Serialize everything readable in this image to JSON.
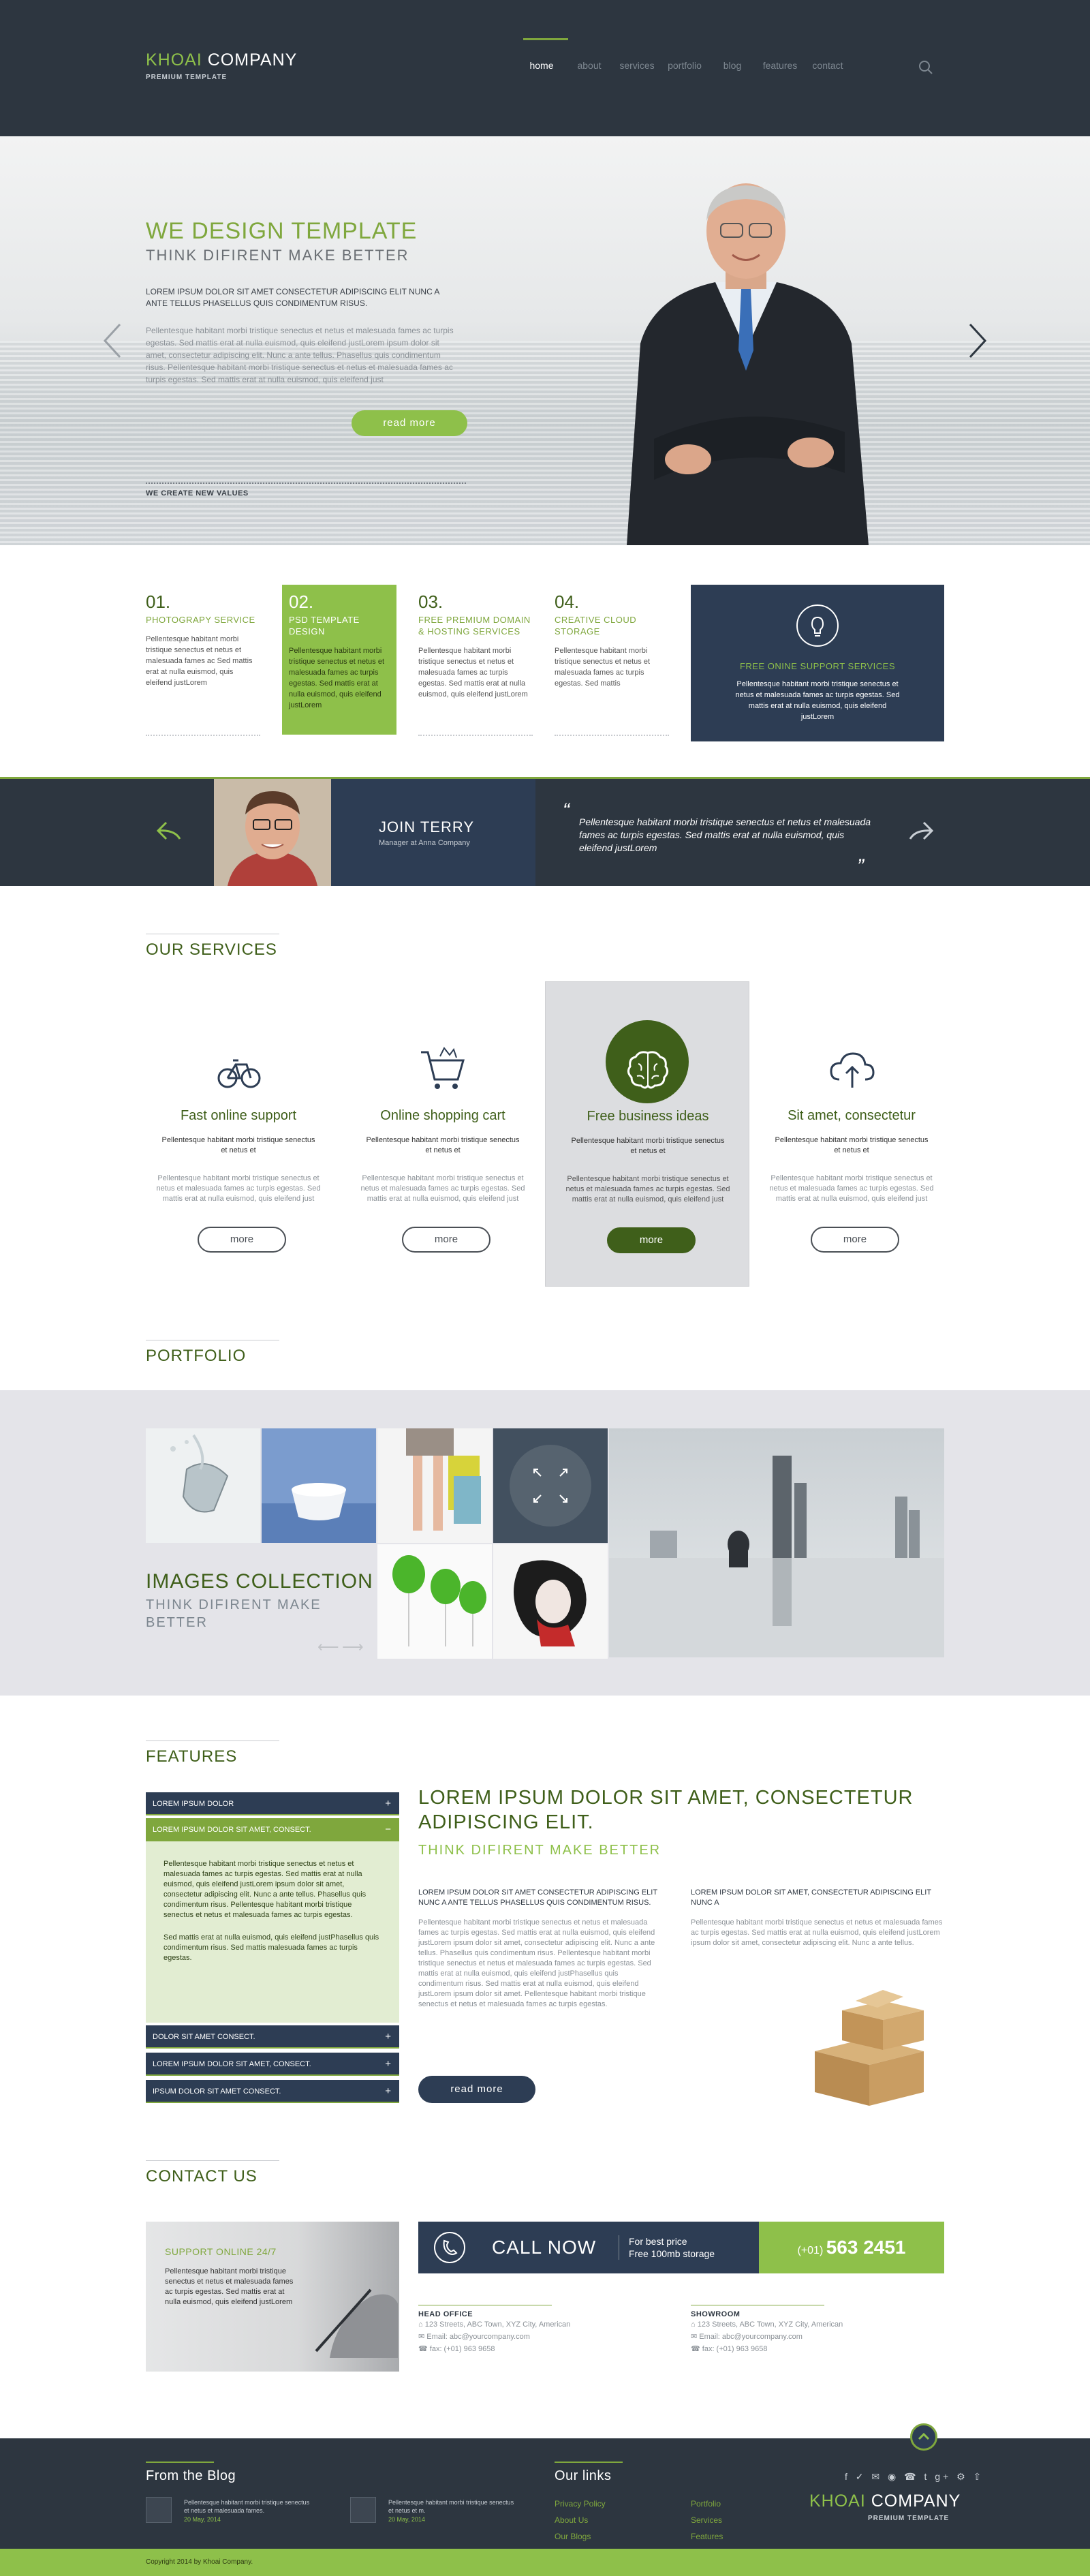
{
  "header": {
    "logo_part1": "KHOAI",
    "logo_part2": "COMPANY",
    "logo_sub": "PREMIUM TEMPLATE",
    "nav": [
      "home",
      "about",
      "services",
      "portfolio",
      "blog",
      "features",
      "contact"
    ]
  },
  "hero": {
    "title": "WE DESIGN TEMPLATE",
    "subtitle": "THINK DIFIRENT MAKE BETTER",
    "lead": "LOREM IPSUM DOLOR SIT AMET CONSECTETUR ADIPISCING ELIT NUNC A ANTE TELLUS PHASELLUS QUIS CONDIMENTUM RISUS.",
    "body": "Pellentesque habitant morbi tristique senectus et netus et malesuada fames ac turpis egestas. Sed mattis erat at nulla euismod, quis eleifend justLorem ipsum dolor sit amet, consectetur adipiscing elit. Nunc a ante tellus. Phasellus quis condimentum risus. Pellentesque habitant morbi tristique senectus et netus et malesuada fames ac turpis egestas. Sed mattis erat at nulla euismod, quis eleifend just",
    "button": "read more",
    "note": "WE CREATE NEW VALUES"
  },
  "services_row": [
    {
      "num": "01.",
      "title": "PHOTOGRAPY SERVICE",
      "text": "Pellentesque habitant morbi tristique senectus et netus et malesuada fames ac Sed mattis erat at nulla euismod, quis eleifend justLorem"
    },
    {
      "num": "02.",
      "title": "PSD TEMPLATE DESIGN",
      "text": "Pellentesque habitant morbi tristique senectus et netus et malesuada fames ac turpis egestas. Sed mattis erat at nulla euismod, quis eleifend justLorem"
    },
    {
      "num": "03.",
      "title": "FREE PREMIUM DOMAIN & HOSTING SERVICES",
      "text": "Pellentesque habitant morbi tristique senectus et netus et malesuada fames ac turpis egestas. Sed mattis erat at nulla euismod, quis eleifend justLorem"
    },
    {
      "num": "04.",
      "title": "CREATIVE CLOUD STORAGE",
      "text": "Pellentesque habitant morbi tristique senectus et netus et malesuada fames ac turpis egestas. Sed mattis"
    }
  ],
  "support": {
    "title": "FREE ONINE SUPPORT SERVICES",
    "text": "Pellentesque habitant morbi tristique senectus et netus et malesuada fames ac turpis egestas. Sed mattis erat at nulla euismod, quis eleifend justLorem"
  },
  "testimonial": {
    "name": "JOIN TERRY",
    "role": "Manager at Anna Company",
    "quote": "Pellentesque habitant morbi tristique senectus et netus et malesuada fames ac turpis egestas. Sed mattis erat at nulla euismod, quis eleifend justLorem"
  },
  "our_services": {
    "title": "OUR SERVICES",
    "cards": [
      {
        "icon": "bicycle-icon",
        "title": "Fast online support",
        "short": "Pellentesque habitant morbi tristique senectus et netus et",
        "long": "Pellentesque habitant morbi tristique senectus et netus et malesuada fames ac turpis egestas. Sed mattis erat at nulla euismod, quis eleifend just",
        "button": "more"
      },
      {
        "icon": "cart-icon",
        "title": "Online shopping cart",
        "short": "Pellentesque habitant morbi tristique senectus et netus et",
        "long": "Pellentesque habitant morbi tristique senectus et netus et malesuada fames ac turpis egestas. Sed mattis erat at nulla euismod, quis eleifend just",
        "button": "more"
      },
      {
        "icon": "brain-icon",
        "title": "Free business ideas",
        "short": "Pellentesque habitant morbi tristique senectus et netus et",
        "long": "Pellentesque habitant morbi tristique senectus et netus et malesuada fames ac turpis egestas. Sed mattis erat at nulla euismod, quis eleifend just",
        "button": "more"
      },
      {
        "icon": "cloud-upload-icon",
        "title": "Sit amet, consectetur",
        "short": "Pellentesque habitant morbi tristique senectus et netus et",
        "long": "Pellentesque habitant morbi tristique senectus et netus et malesuada fames ac turpis egestas. Sed mattis erat at nulla euismod, quis eleifend just",
        "button": "more"
      }
    ]
  },
  "portfolio": {
    "title": "PORTFOLIO",
    "collection_title": "IMAGES COLLECTION",
    "collection_sub": "THINK DIFIRENT MAKE BETTER"
  },
  "features": {
    "title": "FEATURES",
    "accordion": [
      "LOREM IPSUM DOLOR",
      "LOREM IPSUM DOLOR SIT AMET, CONSECT.",
      "DOLOR SIT AMET CONSECT.",
      "LOREM IPSUM DOLOR SIT AMET, CONSECT.",
      "IPSUM DOLOR SIT AMET CONSECT."
    ],
    "accordion_p1": "Pellentesque habitant morbi tristique senectus et netus et malesuada fames ac turpis egestas. Sed mattis erat at nulla euismod, quis eleifend justLorem ipsum dolor sit amet, consectetur adipiscing elit. Nunc a ante tellus. Phasellus quis condimentum risus. Pellentesque habitant morbi tristique senectus et netus et malesuada fames ac turpis egestas.",
    "accordion_p2": "Sed mattis erat at nulla euismod, quis eleifend justPhasellus quis condimentum risus. Sed mattis malesuada fames ac turpis egestas.",
    "headline": "LOREM IPSUM DOLOR SIT AMET, CONSECTETUR ADIPISCING ELIT.",
    "sub": "THINK DIFIRENT MAKE BETTER",
    "col1_head": "LOREM IPSUM DOLOR SIT AMET CONSECTETUR ADIPISCING ELIT NUNC A ANTE TELLUS PHASELLUS QUIS CONDIMENTUM RISUS.",
    "col1_body": "Pellentesque habitant morbi tristique senectus et netus et malesuada fames ac turpis egestas. Sed mattis erat at nulla euismod, quis eleifend justLorem ipsum dolor sit amet, consectetur adipiscing elit. Nunc a ante tellus. Phasellus quis condimentum risus. Pellentesque habitant morbi tristique senectus et netus et malesuada fames ac turpis egestas. Sed mattis erat at nulla euismod, quis eleifend justPhasellus quis condimentum risus. Sed mattis erat at nulla euismod, quis eleifend justLorem ipsum dolor sit amet. Pellentesque habitant morbi tristique senectus et netus et malesuada fames ac turpis egestas.",
    "col2_head": "LOREM IPSUM DOLOR SIT AMET, CONSECTETUR ADIPISCING ELIT NUNC A",
    "col2_body": "Pellentesque habitant morbi tristique senectus et netus et malesuada fames ac turpis egestas. Sed mattis erat at nulla euismod, quis eleifend justLorem ipsum dolor sit amet, consectetur adipiscing elit. Nunc a ante tellus.",
    "button": "read more"
  },
  "contact": {
    "title": "CONTACT US",
    "support_title": "SUPPORT ONLINE 24/7",
    "support_text": "Pellentesque habitant morbi tristique senectus et netus et malesuada fames ac turpis egestas. Sed mattis erat at nulla euismod, quis eleifend justLorem",
    "call": "CALL NOW",
    "best_price": "For best price",
    "storage": "Free 100mb storage",
    "phone_prefix": "(+01)",
    "phone": "563 2451",
    "head_office": {
      "title": "HEAD OFFICE",
      "address": "123 Streets, ABC Town, XYZ City, American",
      "email": "Email: abc@yourcompany.com",
      "fax": "fax: (+01) 963 9658"
    },
    "showroom": {
      "title": "SHOWROOM",
      "address": "123 Streets, ABC Town, XYZ City, American",
      "email": "Email: abc@yourcompany.com",
      "fax": "fax: (+01) 963 9658"
    }
  },
  "footer": {
    "blog_title": "From the Blog",
    "blog": [
      {
        "text": "Pellentesque habitant morbi tristique senectus et netus et malesuada fames.",
        "date": "20 May, 2014"
      },
      {
        "text": "Pellentesque habitant morbi tristique senectus et netus et m.",
        "date": "20 May, 2014"
      }
    ],
    "links_title": "Our links",
    "links_col1": [
      "Privacy Policy",
      "About Us",
      "Our Blogs"
    ],
    "links_col2": [
      "Portfolio",
      "Services",
      "Features"
    ],
    "social": "f ✓ ✉ ◉ ☎ t g+ ⚙ ⇧",
    "logo_part1": "KHOAI",
    "logo_part2": "COMPANY",
    "logo_sub": "PREMIUM TEMPLATE",
    "copyright": "Copyright 2014 by Khoai Company."
  },
  "colors": {
    "accent": "#8ec04a",
    "dark_green": "#3f5f1a",
    "navy": "#2d3d54",
    "charcoal": "#2d3640"
  }
}
